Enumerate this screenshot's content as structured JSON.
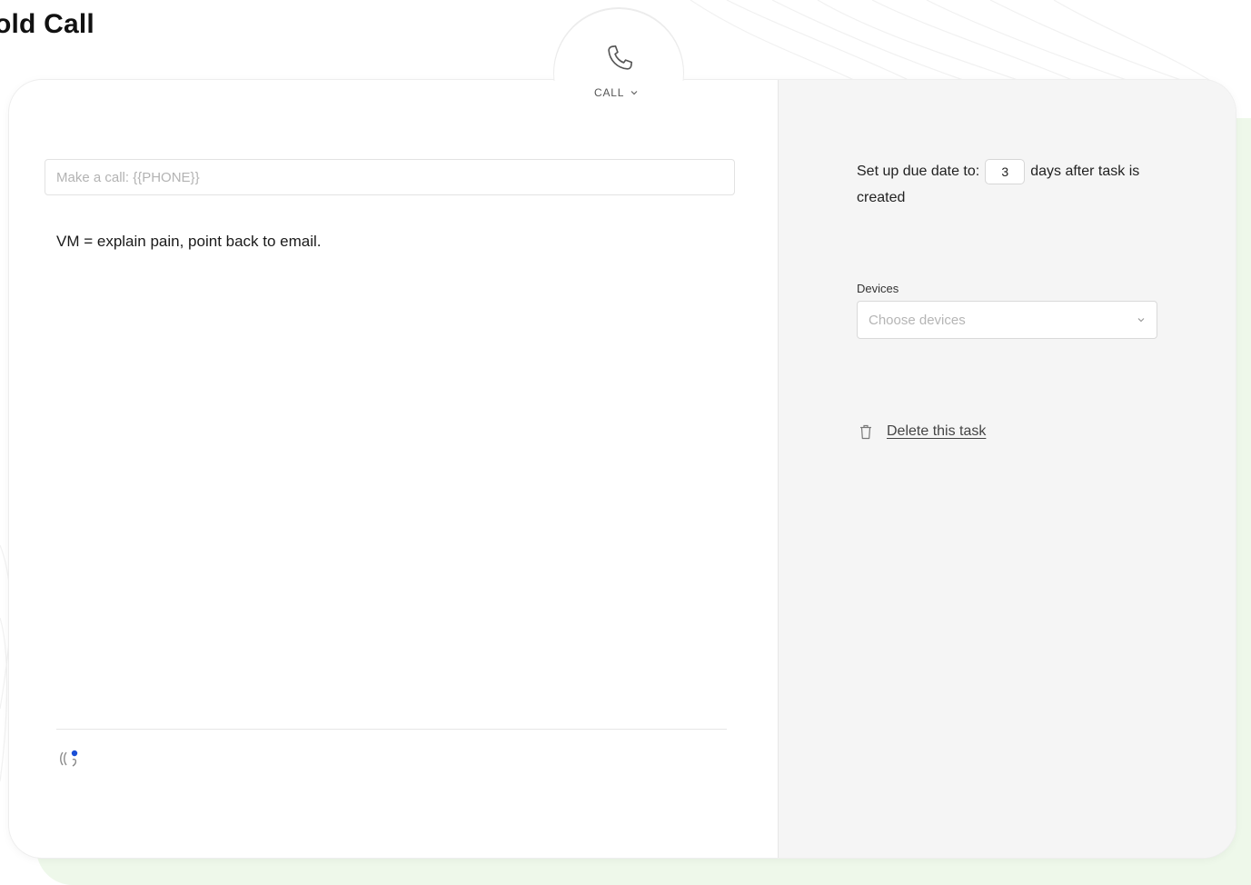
{
  "page": {
    "title": "old Call"
  },
  "step": {
    "type_label": "CALL",
    "type_icon": "phone-icon"
  },
  "editor": {
    "call_placeholder": "Make a call: {{PHONE}}",
    "note": "VM = explain pain, point back to email."
  },
  "settings": {
    "due_prefix": "Set up due date to:",
    "due_days": "3",
    "due_suffix": "days after task is created",
    "devices_label": "Devices",
    "devices_placeholder": "Choose devices",
    "delete_label": "Delete this task"
  },
  "colors": {
    "accent_green_bg": "#eef8ea",
    "panel_gray": "#f5f5f5",
    "grammar_blue": "#1a4fd6"
  }
}
